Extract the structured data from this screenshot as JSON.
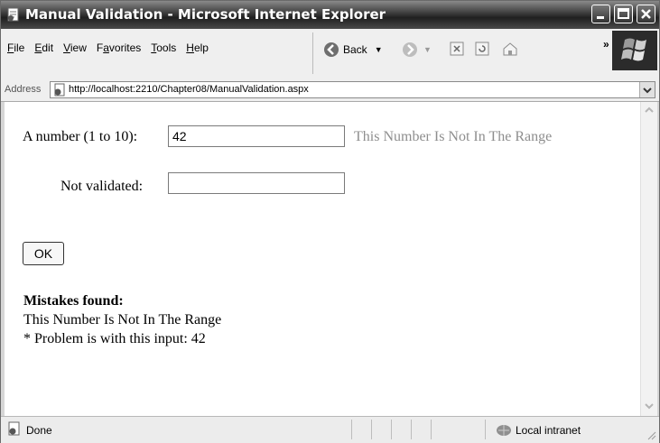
{
  "window": {
    "title": "Manual Validation - Microsoft Internet Explorer"
  },
  "menu": [
    {
      "label": "File",
      "hotkey": "F",
      "rest": "ile"
    },
    {
      "label": "Edit",
      "hotkey": "E",
      "rest": "dit"
    },
    {
      "label": "View",
      "hotkey": "V",
      "rest": "iew"
    },
    {
      "label": "Favorites",
      "hotkey": "a",
      "pre": "F",
      "rest": "vorites"
    },
    {
      "label": "Tools",
      "hotkey": "T",
      "rest": "ools"
    },
    {
      "label": "Help",
      "hotkey": "H",
      "rest": "elp"
    }
  ],
  "toolbar": {
    "back_label": "Back",
    "overflow": "»"
  },
  "address": {
    "label": "Address",
    "url": "http://localhost:2210/Chapter08/ManualValidation.aspx"
  },
  "form": {
    "number_label": "A number (1 to 10):",
    "number_value": "42",
    "number_error": "This Number Is Not In The Range",
    "notvalidated_label": "Not validated:",
    "notvalidated_value": "",
    "ok_label": "OK"
  },
  "summary": {
    "heading": "Mistakes found:",
    "line1": "This Number Is Not In The Range",
    "line2": "* Problem is with this input: 42"
  },
  "status": {
    "text": "Done",
    "zone": "Local intranet"
  }
}
